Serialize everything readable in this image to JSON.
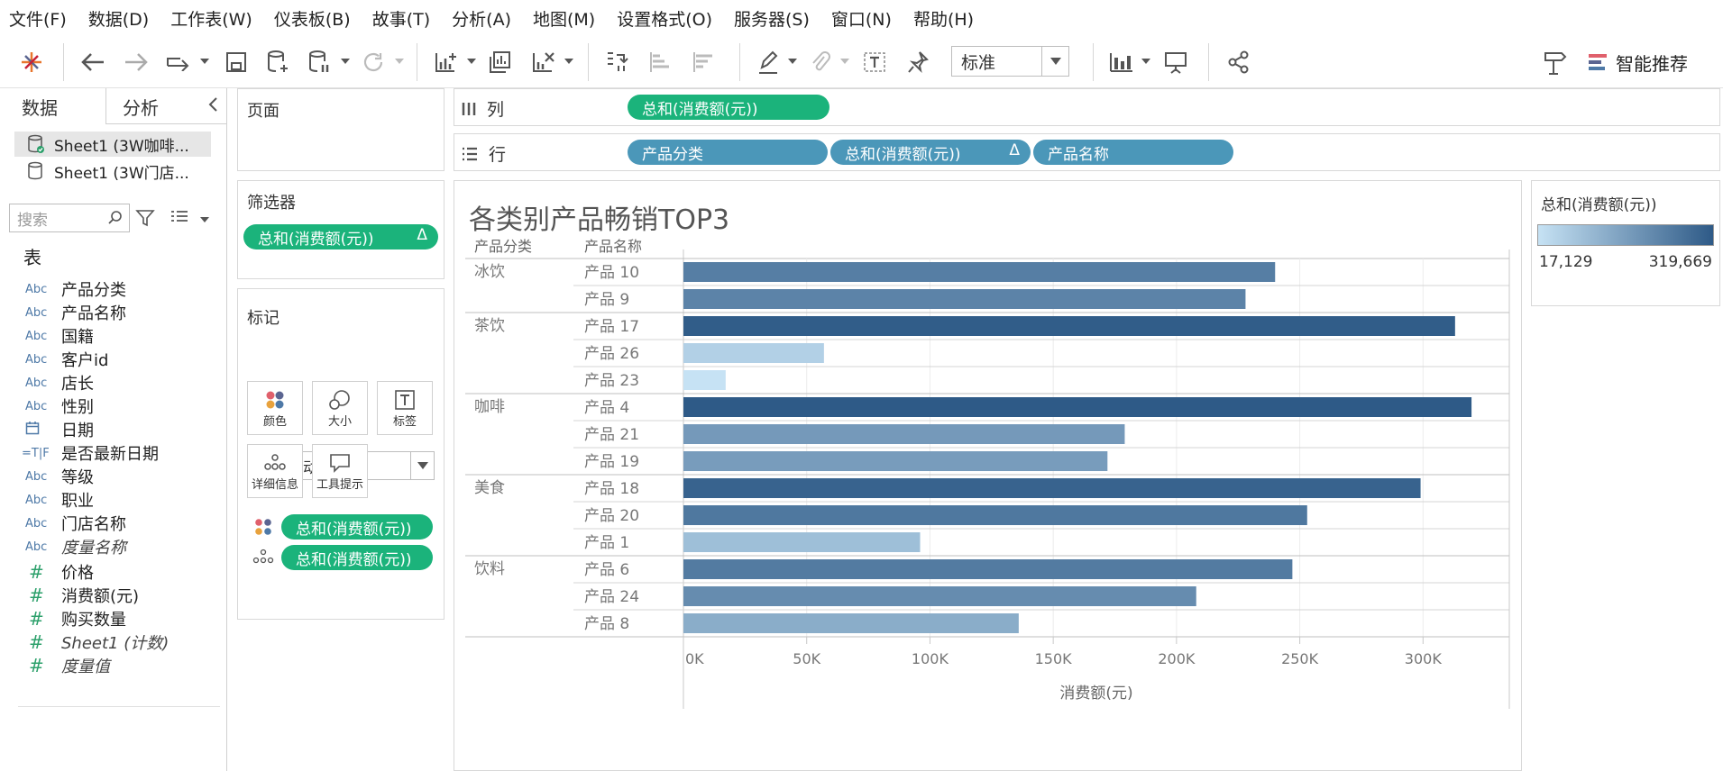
{
  "menu": [
    "文件(F)",
    "数据(D)",
    "工作表(W)",
    "仪表板(B)",
    "故事(T)",
    "分析(A)",
    "地图(M)",
    "设置格式(O)",
    "服务器(S)",
    "窗口(N)",
    "帮助(H)"
  ],
  "toolbar": {
    "fit_value": "标准",
    "show_me": "智能推荐"
  },
  "data_pane": {
    "tabs": [
      "数据",
      "分析"
    ],
    "datasources": [
      "Sheet1 (3W咖啡...",
      "Sheet1 (3W门店..."
    ],
    "search_placeholder": "搜索",
    "table_header": "表",
    "dimensions": [
      {
        "icon": "Abc",
        "name": "产品分类"
      },
      {
        "icon": "Abc",
        "name": "产品名称"
      },
      {
        "icon": "Abc",
        "name": "国籍"
      },
      {
        "icon": "Abc",
        "name": "客户id"
      },
      {
        "icon": "Abc",
        "name": "店长"
      },
      {
        "icon": "Abc",
        "name": "性别"
      },
      {
        "icon": "calendar",
        "name": "日期"
      },
      {
        "icon": "=T|F",
        "name": "是否最新日期"
      },
      {
        "icon": "Abc",
        "name": "等级"
      },
      {
        "icon": "Abc",
        "name": "职业"
      },
      {
        "icon": "Abc",
        "name": "门店名称"
      },
      {
        "icon": "Abc",
        "name": "度量名称"
      }
    ],
    "measures": [
      {
        "icon": "#",
        "name": "价格"
      },
      {
        "icon": "#",
        "name": "消费额(元)"
      },
      {
        "icon": "#",
        "name": "购买数量"
      },
      {
        "icon": "#",
        "name": "Sheet1 (计数)"
      },
      {
        "icon": "#",
        "name": "度量值"
      }
    ]
  },
  "pages_shelf": {
    "title": "页面"
  },
  "filters_shelf": {
    "title": "筛选器",
    "pill": "总和(消费额(元))",
    "pill_delta": "Δ"
  },
  "marks_card": {
    "title": "标记",
    "mark_type": "自动",
    "buttons": [
      "颜色",
      "大小",
      "标签",
      "详细信息",
      "工具提示"
    ],
    "color_pill": "总和(消费额(元))",
    "detail_pill": "总和(消费额(元))"
  },
  "columns_shelf": {
    "label": "列",
    "pills": [
      "总和(消费额(元))"
    ]
  },
  "rows_shelf": {
    "label": "行",
    "pills": [
      "产品分类",
      "总和(消费额(元))",
      "产品名称"
    ],
    "delta": "Δ"
  },
  "legend": {
    "title": "总和(消费额(元))",
    "min": "17,129",
    "max": "319,669",
    "color_low": "#c6e2f4",
    "color_high": "#2e5a87"
  },
  "chart_data": {
    "type": "bar",
    "orientation": "horizontal",
    "title": "各类别产品畅销TOP3",
    "row_headers": [
      "产品分类",
      "产品名称"
    ],
    "xlabel": "消费额(元)",
    "xlim": [
      0,
      335000
    ],
    "xticks": [
      "0K",
      "50K",
      "100K",
      "150K",
      "200K",
      "250K",
      "300K"
    ],
    "grid": true,
    "groups": [
      {
        "category": "冰饮",
        "items": [
          {
            "name": "产品 10",
            "value": 240000
          },
          {
            "name": "产品 9",
            "value": 228000
          }
        ]
      },
      {
        "category": "茶饮",
        "items": [
          {
            "name": "产品 17",
            "value": 313000
          },
          {
            "name": "产品 26",
            "value": 57000
          },
          {
            "name": "产品 23",
            "value": 17129
          }
        ]
      },
      {
        "category": "咖啡",
        "items": [
          {
            "name": "产品 4",
            "value": 319669
          },
          {
            "name": "产品 21",
            "value": 179000
          },
          {
            "name": "产品 19",
            "value": 172000
          }
        ]
      },
      {
        "category": "美食",
        "items": [
          {
            "name": "产品 18",
            "value": 299000
          },
          {
            "name": "产品 20",
            "value": 253000
          },
          {
            "name": "产品 1",
            "value": 96000
          }
        ]
      },
      {
        "category": "饮料",
        "items": [
          {
            "name": "产品 6",
            "value": 247000
          },
          {
            "name": "产品 24",
            "value": 208000
          },
          {
            "name": "产品 8",
            "value": 136000
          }
        ]
      }
    ]
  }
}
